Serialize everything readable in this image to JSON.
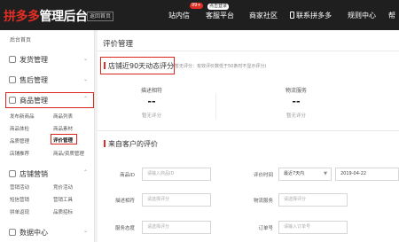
{
  "topbar": {
    "logo_brand": "拼多多",
    "logo_rest": "管理后台",
    "back_label": "返回首页",
    "nav_station": "站内信",
    "nav_badge": "99+",
    "nav_tip": "点击登录",
    "nav_customer": "客服平台",
    "nav_community": "商家社区",
    "nav_contact": "联系拼多多",
    "nav_rules": "规则中心",
    "nav_help": "帮"
  },
  "sidebar": {
    "breadcrumb": "后台首页",
    "sections": [
      {
        "label": "发货管理"
      },
      {
        "label": "售后管理"
      },
      {
        "label": "商品管理"
      },
      {
        "label": "店铺营销"
      },
      {
        "label": "数据中心"
      }
    ],
    "goods_items": [
      "发布新商品",
      "商品列表",
      "商品体检",
      "商品素材",
      "品质管理",
      "评价管理",
      "店铺推荐",
      "商品/资质管理"
    ],
    "marketing_items": [
      "营销活动",
      "竞价活动",
      "短信营销",
      "营销工具",
      "拼单返现",
      "品质招标"
    ]
  },
  "main": {
    "page_title": "评价管理",
    "rating_section_title": "店铺近90天动态评分",
    "rating_note": "(暂无评分：有效评价数低于50条时不显示评分)",
    "metrics": [
      {
        "label": "描述相符",
        "value": "--",
        "sub": "暂无评分"
      },
      {
        "label": "物流服务",
        "value": "--",
        "sub": "暂无评分"
      }
    ],
    "reviews_section_title": "来自客户的评价",
    "filters": {
      "goods_id": {
        "label": "商品ID",
        "placeholder": "请输入商品ID"
      },
      "eval_time": {
        "label": "评价时间",
        "value": "最近7天内",
        "date": "2019-04-22"
      },
      "desc_match": {
        "label": "描述相符",
        "placeholder": "请选择评分"
      },
      "logistics": {
        "label": "物流服务",
        "placeholder": "请选择评分"
      },
      "service": {
        "label": "服务态度",
        "placeholder": "请选择评分"
      },
      "order_no": {
        "label": "订单号",
        "placeholder": "请输入订单号"
      }
    }
  }
}
